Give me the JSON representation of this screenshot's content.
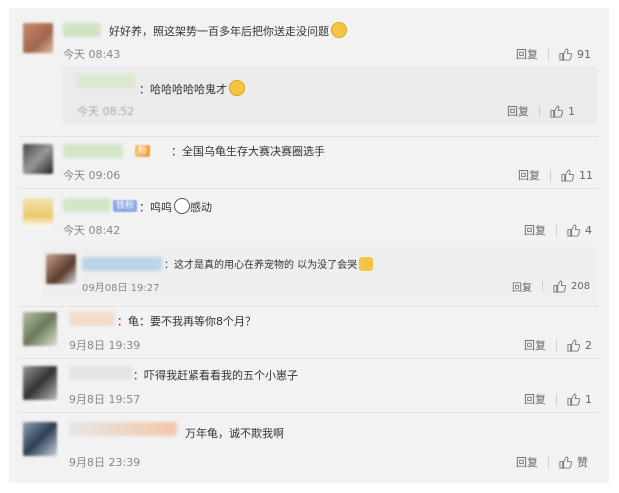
{
  "comments": [
    {
      "text": "好好养，照这架势一百多年后把你送走没问题",
      "emoji": "smiling-face-emoji",
      "time": "今天 08:43",
      "reply_label": "回复",
      "likes": "91",
      "replies": [
        {
          "text": "：哈哈哈哈哈鬼才",
          "emoji": "laughing-emoji",
          "time": "今天 08:52",
          "reply_label": "回复",
          "likes": "1"
        }
      ]
    },
    {
      "badge": "粉",
      "text": "：全国乌龟生存大赛决赛圈选手",
      "time": "今天 09:06",
      "reply_label": "回复",
      "likes": "11"
    },
    {
      "badge": "铁粉",
      "text": "：呜呜",
      "emoji": "moved-emoji",
      "text_after": "感动",
      "time": "今天 08:42",
      "reply_label": "回复",
      "likes": "4",
      "replies": [
        {
          "text": "：这才是真的用心在养宠物的 以为没了会哭",
          "emoji": "pray-emoji",
          "time": "09月08日 19:27",
          "reply_label": "回复",
          "likes": "208"
        }
      ]
    },
    {
      "text": "：龟：要不我再等你8个月？",
      "time": "9月8日 19:39",
      "reply_label": "回复",
      "likes": "2"
    },
    {
      "text": "：吓得我赶紧看看我的五个小崽子",
      "time": "9月8日 19:57",
      "reply_label": "回复",
      "likes": "1"
    },
    {
      "text": "万年龟，诚不欺我啊",
      "time": "9月8日 23:39",
      "reply_label": "回复",
      "likes": "赞"
    }
  ],
  "colors": {
    "background": "#f2f2f2",
    "nested_background": "#ebebeb",
    "text": "#333333",
    "muted": "#888888"
  }
}
